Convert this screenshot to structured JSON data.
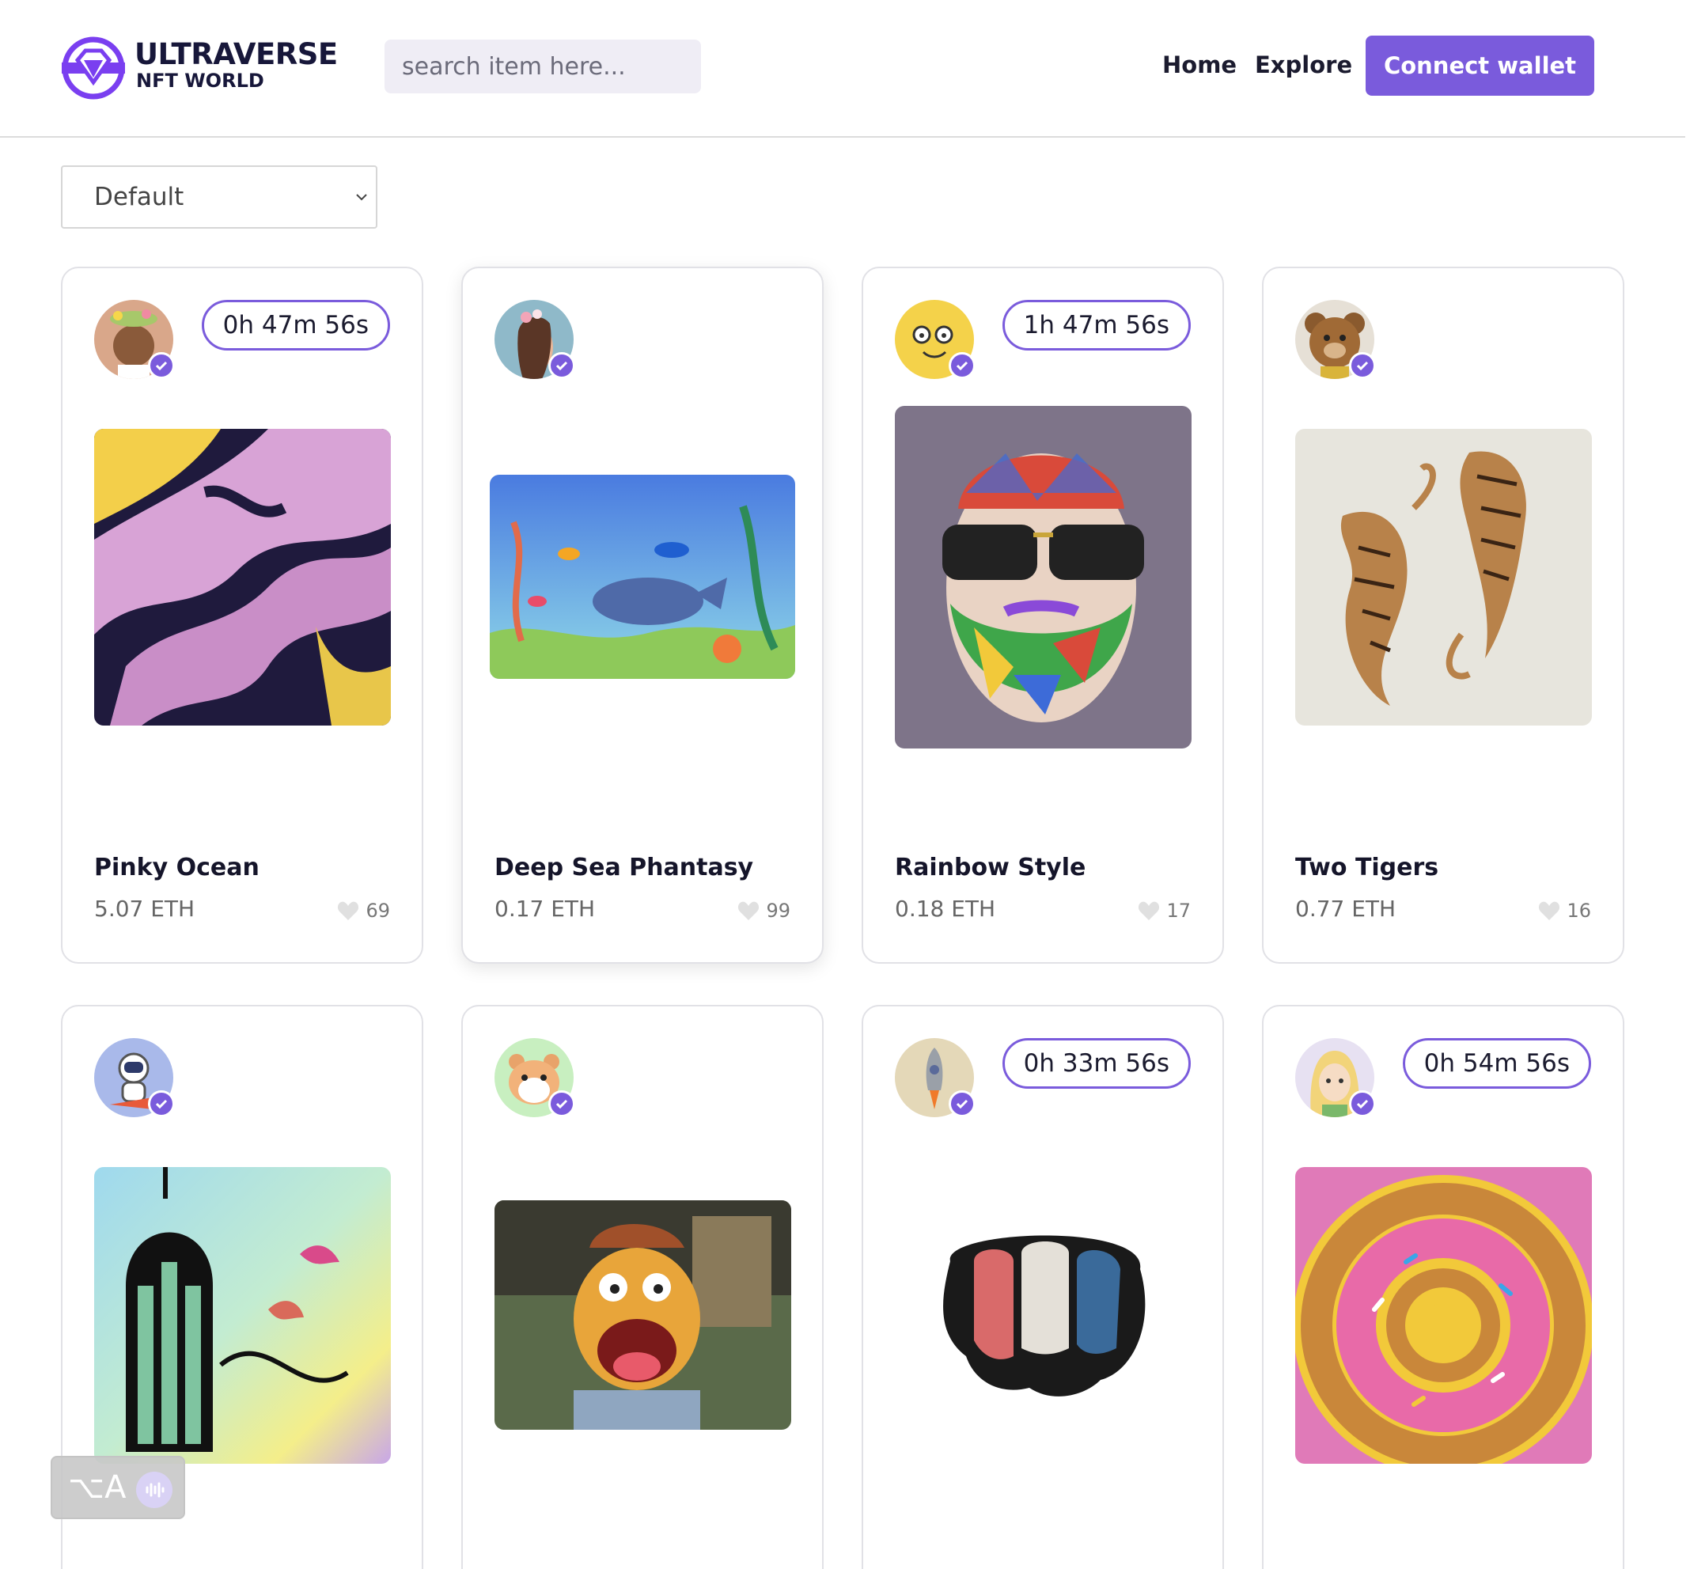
{
  "header": {
    "logo_line1": "ULTRAVERSE",
    "logo_line2": "NFT WORLD",
    "search_placeholder": "search item here...",
    "nav": {
      "home": "Home",
      "explore": "Explore"
    },
    "connect_label": "Connect wallet"
  },
  "sort": {
    "selected": "Default"
  },
  "colors": {
    "accent": "#7a5bdc",
    "text": "#1b1b2f",
    "muted": "#666666"
  },
  "cards": [
    {
      "title": "Pinky Ocean",
      "price": "5.07 ETH",
      "likes": "69",
      "timer": "0h 47m 56s",
      "avatar_icon": "woman-flower-crown-avatar",
      "art": "pink-marble-art"
    },
    {
      "title": "Deep Sea Phantasy",
      "price": "0.17 ETH",
      "likes": "99",
      "timer": "",
      "avatar_icon": "woman-profile-avatar",
      "art": "underwater-scene-art"
    },
    {
      "title": "Rainbow Style",
      "price": "0.18 ETH",
      "likes": "17",
      "timer": "1h 47m 56s",
      "avatar_icon": "smiley-face-avatar",
      "art": "mosaic-beard-portrait-art"
    },
    {
      "title": "Two Tigers",
      "price": "0.77 ETH",
      "likes": "16",
      "timer": "",
      "avatar_icon": "teddy-bear-avatar",
      "art": "two-tigers-art"
    },
    {
      "title": "",
      "price": "",
      "likes": "",
      "timer": "",
      "avatar_icon": "astronaut-rocket-avatar",
      "art": "truth-birdcage-art"
    },
    {
      "title": "",
      "price": "",
      "likes": "",
      "timer": "",
      "avatar_icon": "hamster-avatar",
      "art": "muppet-scream-art"
    },
    {
      "title": "",
      "price": "",
      "likes": "",
      "timer": "0h 33m 56s",
      "avatar_icon": "rocket-avatar",
      "art": "melting-brain-art"
    },
    {
      "title": "",
      "price": "",
      "likes": "",
      "timer": "0h 54m 56s",
      "avatar_icon": "blonde-girl-avatar",
      "art": "donut-swirl-art"
    }
  ],
  "widget": {
    "label": "⌥A"
  }
}
